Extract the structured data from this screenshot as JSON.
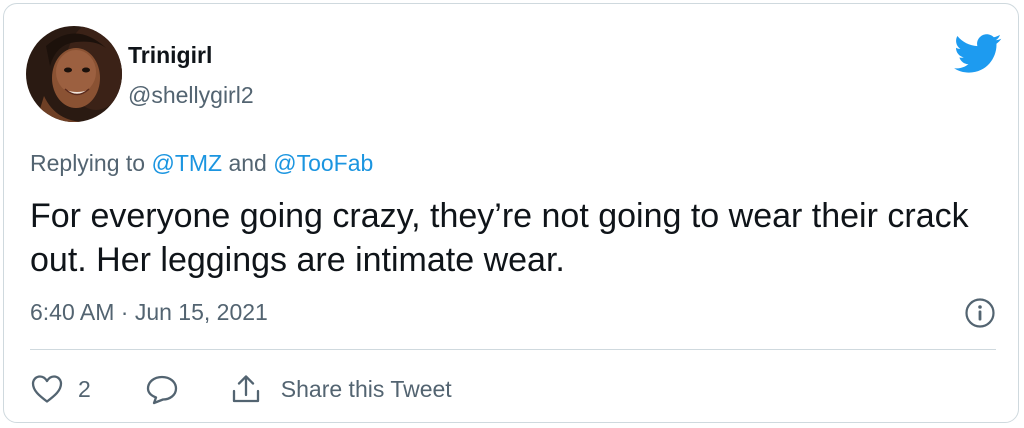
{
  "author": {
    "display_name": "Trinigirl",
    "handle": "@shellygirl2"
  },
  "reply": {
    "prefix": "Replying to ",
    "mention_1": "@TMZ",
    "conjunction": " and ",
    "mention_2": "@TooFab"
  },
  "tweet": {
    "text": "For everyone going crazy, they’re not going to wear their crack out. Her leggings are intimate wear.",
    "timestamp": "6:40 AM · Jun 15, 2021"
  },
  "actions": {
    "like_count": "2",
    "share_label": "Share this Tweet"
  },
  "icons": {
    "brand": "twitter-bird-icon",
    "info": "info-icon",
    "like": "heart-icon",
    "reply": "speech-bubble-icon",
    "share": "share-upload-icon"
  },
  "colors": {
    "brand_blue": "#1d9bf0",
    "mention_blue": "#1b95e0",
    "secondary_text": "#536471",
    "primary_text": "#0f1419",
    "border": "#cfd9de"
  }
}
